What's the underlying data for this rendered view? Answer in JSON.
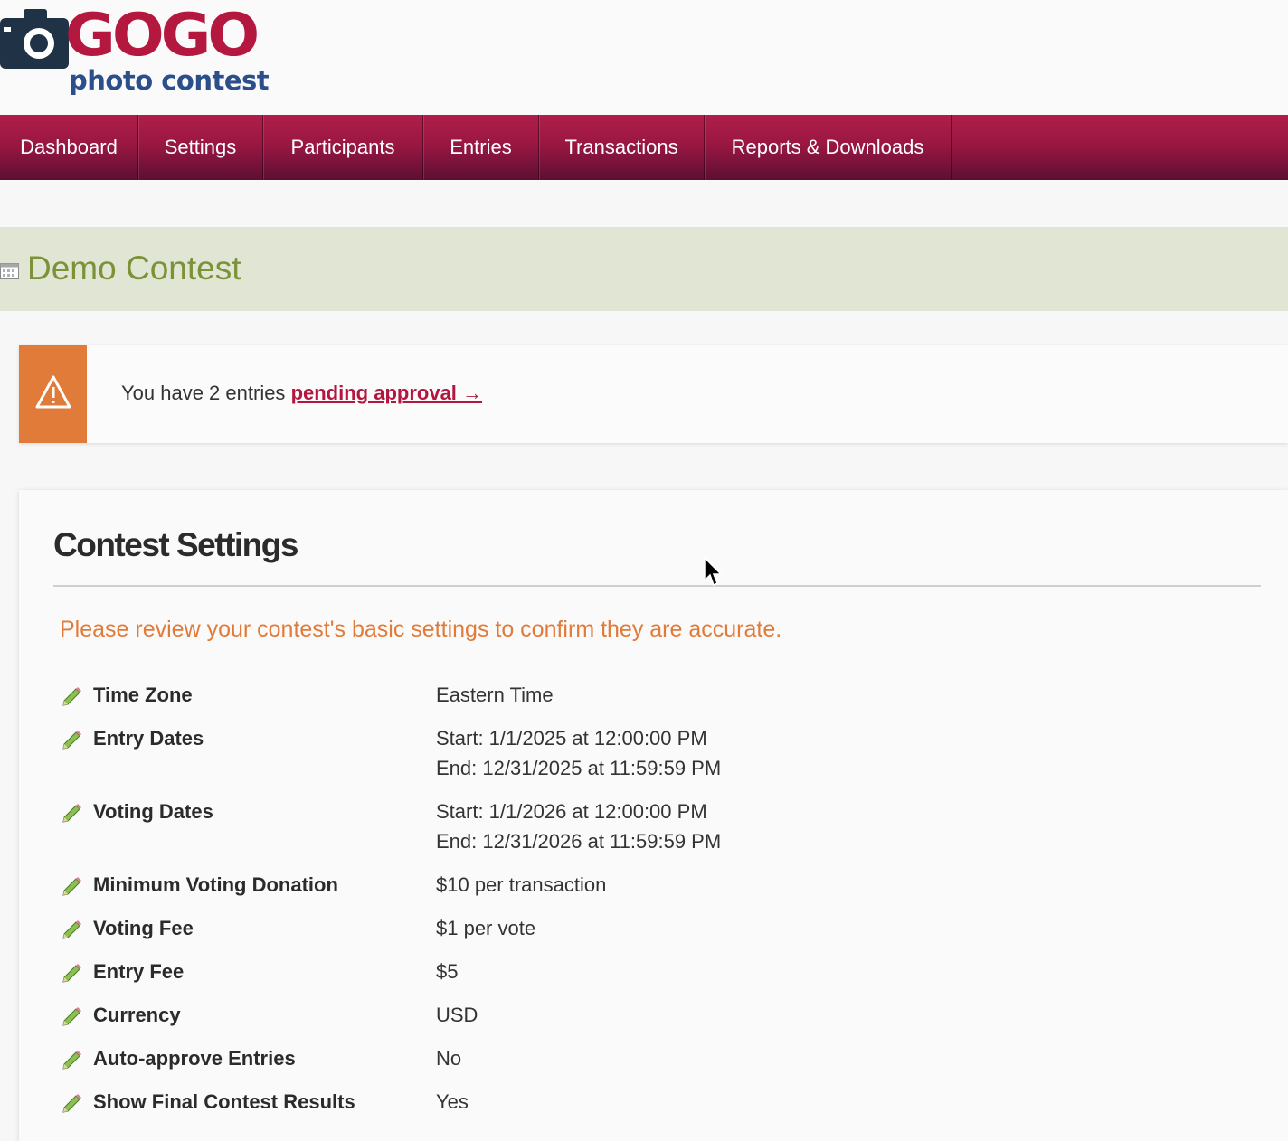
{
  "logo": {
    "word": "GOGO",
    "subtitle": "photo contest"
  },
  "nav": {
    "items": [
      {
        "label": "Dashboard"
      },
      {
        "label": "Settings"
      },
      {
        "label": "Participants"
      },
      {
        "label": "Entries"
      },
      {
        "label": "Transactions"
      },
      {
        "label": "Reports & Downloads"
      }
    ]
  },
  "contest": {
    "title": "Demo Contest",
    "icon": "calendar-icon"
  },
  "alert": {
    "icon": "warning-icon",
    "text": "You have 2 entries ",
    "link_label": "pending approval →"
  },
  "settings_card": {
    "title": "Contest Settings",
    "notice": "Please review your contest's basic settings to confirm they are accurate.",
    "rows": [
      {
        "label": "Time Zone",
        "values": [
          "Eastern Time"
        ]
      },
      {
        "label": "Entry Dates",
        "values": [
          "Start: 1/1/2025 at 12:00:00 PM",
          "End: 12/31/2025 at 11:59:59 PM"
        ]
      },
      {
        "label": "Voting Dates",
        "values": [
          "Start: 1/1/2026 at 12:00:00 PM",
          "End: 12/31/2026 at 11:59:59 PM"
        ]
      },
      {
        "label": "Minimum Voting Donation",
        "values": [
          "$10 per transaction"
        ]
      },
      {
        "label": "Voting Fee",
        "values": [
          "$1 per vote"
        ]
      },
      {
        "label": "Entry Fee",
        "values": [
          "$5"
        ]
      },
      {
        "label": "Currency",
        "values": [
          "USD"
        ]
      },
      {
        "label": "Auto-approve Entries",
        "values": [
          "No"
        ]
      },
      {
        "label": "Show Final Contest Results",
        "values": [
          "Yes"
        ]
      }
    ]
  },
  "colors": {
    "brand": "#b5183f",
    "nav_top": "#b01e4a",
    "nav_bottom": "#5d0f33",
    "title_green": "#7b9236",
    "title_bar": "#e1e6d4",
    "warning": "#e07b3a",
    "logo_blue": "#2c4f8c"
  }
}
